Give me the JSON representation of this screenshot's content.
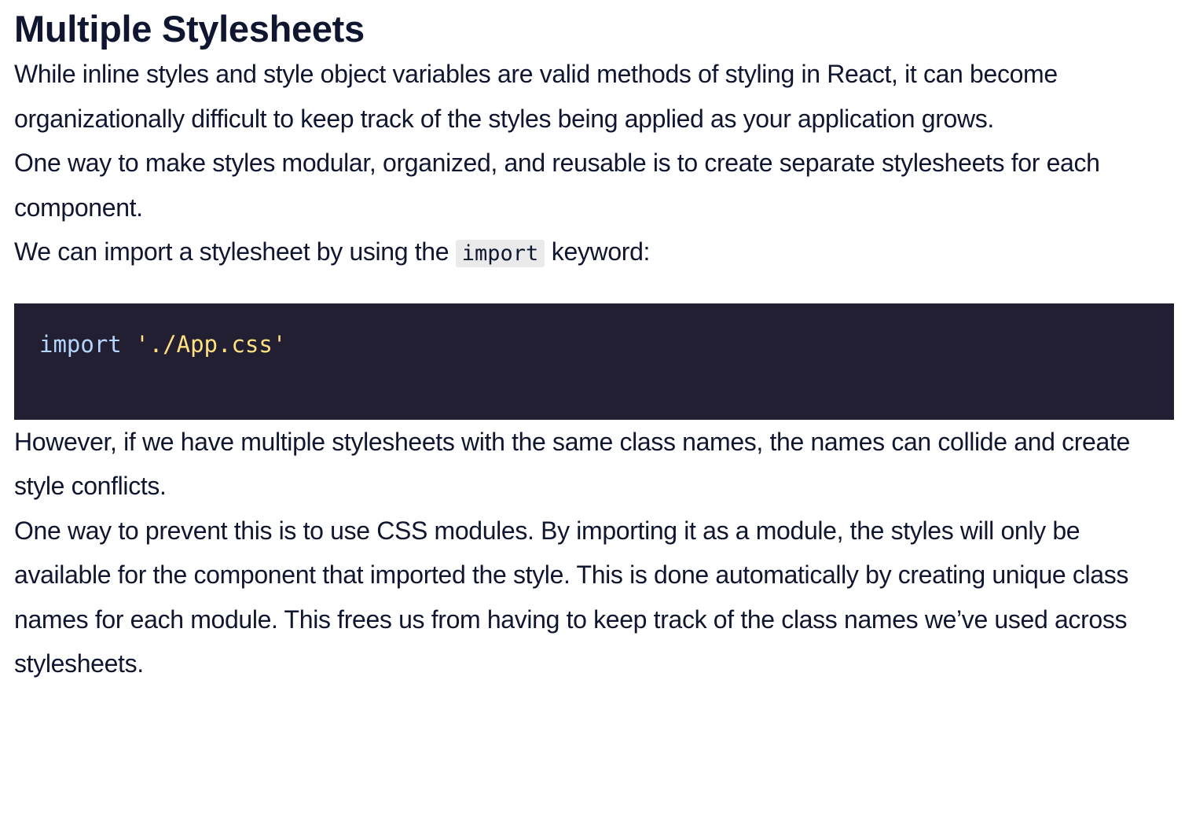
{
  "heading": "Multiple Stylesheets",
  "paragraphs": {
    "p1": "While inline styles and style object variables are valid methods of styling in React, it can become organizationally difficult to keep track of the styles being applied as your application grows.",
    "p2": "One way to make styles modular, organized, and reusable is to create separate stylesheets for each component.",
    "p3_before": "We can import a stylesheet by using the ",
    "p3_code": "import",
    "p3_after": " keyword:",
    "p4": "However, if we have multiple stylesheets with the same class names, the names can collide and create style conflicts.",
    "p5": "One way to prevent this is to use CSS modules. By importing it as a module, the styles will only be available for the component that imported the style. This is done automatically by creating unique class names for each module. This frees us from having to keep track of the class names we’ve used across stylesheets."
  },
  "code_block": {
    "keyword": "import",
    "space": " ",
    "string": "'./App.css'"
  },
  "colors": {
    "text": "#10162f",
    "code_bg": "#211f31",
    "code_keyword": "#b4d6ff",
    "code_string": "#ffe083",
    "inline_code_bg": "#eaeaea"
  }
}
